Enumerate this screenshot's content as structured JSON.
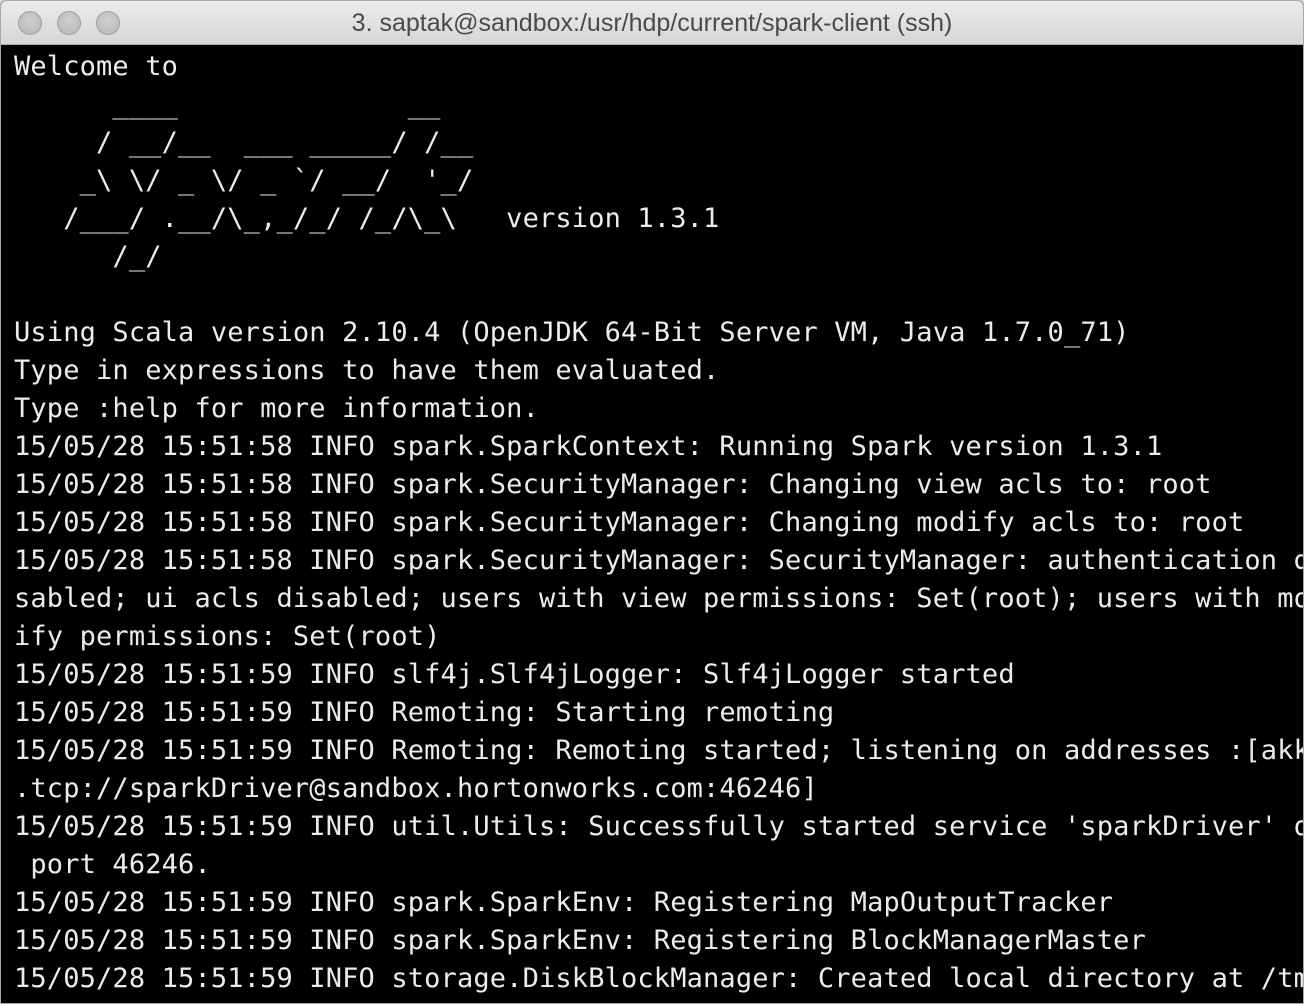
{
  "window": {
    "title": "3. saptak@sandbox:/usr/hdp/current/spark-client (ssh)"
  },
  "terminal": {
    "lines": [
      "Welcome to",
      "      ____              __",
      "     / __/__  ___ _____/ /__",
      "    _\\ \\/ _ \\/ _ `/ __/  '_/",
      "   /___/ .__/\\_,_/_/ /_/\\_\\   version 1.3.1",
      "      /_/",
      "",
      "Using Scala version 2.10.4 (OpenJDK 64-Bit Server VM, Java 1.7.0_71)",
      "Type in expressions to have them evaluated.",
      "Type :help for more information.",
      "15/05/28 15:51:58 INFO spark.SparkContext: Running Spark version 1.3.1",
      "15/05/28 15:51:58 INFO spark.SecurityManager: Changing view acls to: root",
      "15/05/28 15:51:58 INFO spark.SecurityManager: Changing modify acls to: root",
      "15/05/28 15:51:58 INFO spark.SecurityManager: SecurityManager: authentication di",
      "sabled; ui acls disabled; users with view permissions: Set(root); users with mod",
      "ify permissions: Set(root)",
      "15/05/28 15:51:59 INFO slf4j.Slf4jLogger: Slf4jLogger started",
      "15/05/28 15:51:59 INFO Remoting: Starting remoting",
      "15/05/28 15:51:59 INFO Remoting: Remoting started; listening on addresses :[akka",
      ".tcp://sparkDriver@sandbox.hortonworks.com:46246]",
      "15/05/28 15:51:59 INFO util.Utils: Successfully started service 'sparkDriver' on",
      " port 46246.",
      "15/05/28 15:51:59 INFO spark.SparkEnv: Registering MapOutputTracker",
      "15/05/28 15:51:59 INFO spark.SparkEnv: Registering BlockManagerMaster",
      "15/05/28 15:51:59 INFO storage.DiskBlockManager: Created local directory at /tmp"
    ]
  }
}
